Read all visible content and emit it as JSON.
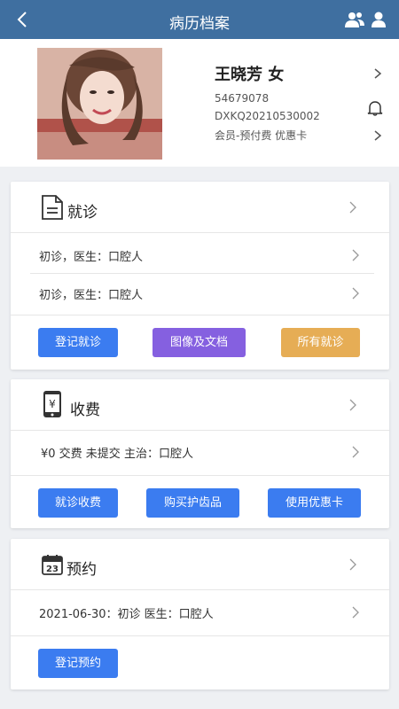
{
  "header": {
    "title": "病历档案"
  },
  "patient": {
    "name": "王晓芳 女",
    "id": "54679078",
    "code": "DXKQ20210530002",
    "membership": "会员-预付费 优惠卡"
  },
  "visits": {
    "title": "就诊",
    "records": [
      "初诊，医生：口腔人",
      "初诊，医生：口腔人"
    ],
    "buttons": {
      "register": "登记就诊",
      "images": "图像及文档",
      "all": "所有就诊"
    }
  },
  "charges": {
    "title": "收费",
    "record": "¥0 交费 未提交 主治：口腔人",
    "buttons": {
      "visit_charge": "就诊收费",
      "buy": "购买护齿品",
      "coupon": "使用优惠卡"
    }
  },
  "appointments": {
    "title": "预约",
    "calendar_day": "23",
    "record": "2021-06-30：初诊 医生：口腔人",
    "buttons": {
      "register": "登记预约"
    }
  },
  "colors": {
    "header": "#3f6fa0",
    "blue": "#3b7cf0",
    "purple": "#8560e0",
    "orange": "#e6ad55"
  }
}
